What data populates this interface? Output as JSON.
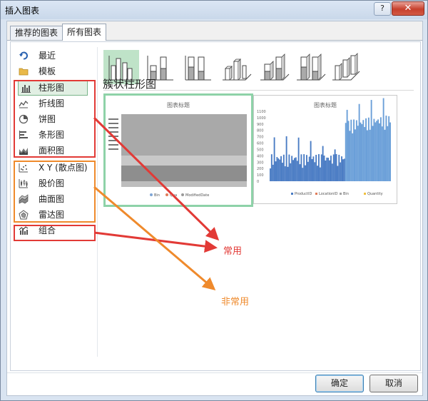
{
  "window": {
    "title": "插入图表",
    "help": "?",
    "close": "✕"
  },
  "tabs": [
    {
      "label": "推荐的图表",
      "active": false
    },
    {
      "label": "所有图表",
      "active": true
    }
  ],
  "categories": [
    {
      "label": "最近",
      "icon": "recent-icon"
    },
    {
      "label": "模板",
      "icon": "folder-icon"
    },
    {
      "label": "柱形图",
      "icon": "column-chart-icon",
      "selected": true
    },
    {
      "label": "折线图",
      "icon": "line-chart-icon"
    },
    {
      "label": "饼图",
      "icon": "pie-chart-icon"
    },
    {
      "label": "条形图",
      "icon": "bar-chart-icon"
    },
    {
      "label": "面积图",
      "icon": "area-chart-icon"
    },
    {
      "label": "X Y (散点图)",
      "icon": "scatter-chart-icon"
    },
    {
      "label": "股价图",
      "icon": "stock-chart-icon"
    },
    {
      "label": "曲面图",
      "icon": "surface-chart-icon"
    },
    {
      "label": "雷达图",
      "icon": "radar-chart-icon"
    },
    {
      "label": "组合",
      "icon": "combo-chart-icon"
    }
  ],
  "subtype_heading": "簇状柱形图",
  "subtypes": [
    "clustered-column-icon",
    "stacked-column-icon",
    "percent-stacked-column-icon",
    "3d-clustered-column-icon",
    "3d-stacked-column-icon",
    "3d-percent-stacked-column-icon",
    "3d-column-icon"
  ],
  "previews": [
    {
      "title": "图表标题",
      "legend": [
        "Bin",
        "Qua",
        "ModifiedDate"
      ]
    },
    {
      "title": "图表标题",
      "y_ticks": [
        "1100",
        "1000",
        "900",
        "800",
        "700",
        "600",
        "500",
        "400",
        "300",
        "200",
        "100",
        "0"
      ],
      "legend": [
        "ProductID",
        "LocationID",
        "Bin",
        "Quantity"
      ]
    }
  ],
  "buttons": {
    "ok": "确定",
    "cancel": "取消"
  },
  "annotations": {
    "common": "常用",
    "uncommon": "非常用"
  },
  "colors": {
    "red": "#e23a36",
    "orange": "#ef8a2c",
    "selected_bg": "#e1efe3",
    "selected_border": "#79b58a",
    "blue_bar": "#4a7cc4",
    "light_blue": "#6a9fd8"
  }
}
